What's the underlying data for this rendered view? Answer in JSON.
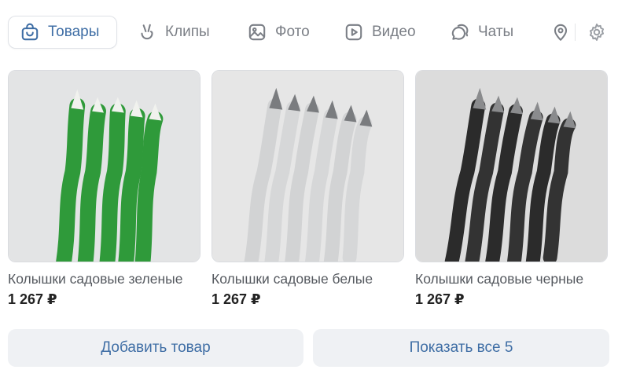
{
  "tabs": [
    {
      "label": "Товары",
      "icon": "bag-icon",
      "active": true
    },
    {
      "label": "Клипы",
      "icon": "clips-icon",
      "active": false
    },
    {
      "label": "Фото",
      "icon": "photo-icon",
      "active": false
    },
    {
      "label": "Видео",
      "icon": "video-icon",
      "active": false
    },
    {
      "label": "Чаты",
      "icon": "chats-icon",
      "active": false
    },
    {
      "label": "",
      "icon": "location-pin-icon",
      "active": false
    },
    {
      "label": "",
      "icon": "gear-icon",
      "active": false
    }
  ],
  "products": [
    {
      "title": "Колышки садовые зеленые",
      "price": "1 267 ₽",
      "color": "#2f9a3a"
    },
    {
      "title": "Колышки садовые белые",
      "price": "1 267 ₽",
      "color": "#d6d7d8"
    },
    {
      "title": "Колышки садовые черные",
      "price": "1 267 ₽",
      "color": "#2b2b2b"
    }
  ],
  "buttons": {
    "add_label": "Добавить товар",
    "show_all_label": "Показать все 5"
  },
  "colors": {
    "accent": "#3f6ea5",
    "tab_inactive": "#7b7f86",
    "button_bg": "#eff1f4"
  }
}
